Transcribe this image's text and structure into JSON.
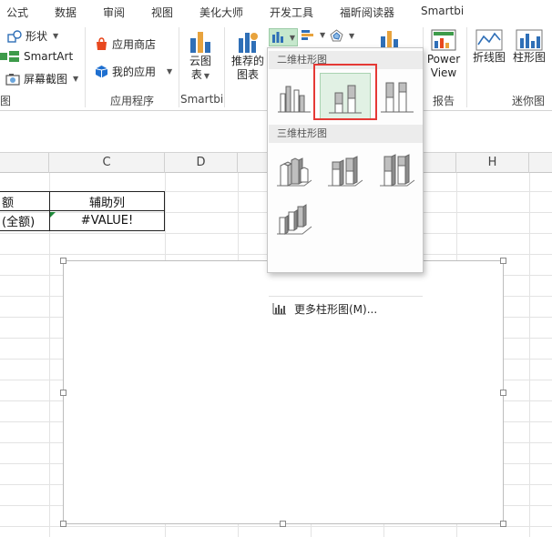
{
  "tabs": [
    "公式",
    "数据",
    "审阅",
    "视图",
    "美化大师",
    "开发工具",
    "福昕阅读器",
    "Smartbi"
  ],
  "ribbon": {
    "illustrations": {
      "shapes_label": "形状",
      "smartart_label": "SmartArt",
      "screenshot_label": "屏幕截图",
      "group_label_partial": "图"
    },
    "apps": {
      "store_label": "应用商店",
      "myapps_label": "我的应用",
      "group_label": "应用程序"
    },
    "smartbi": {
      "cloud_chart_line1": "云图",
      "cloud_chart_line2": "表",
      "group_label": "Smartbi"
    },
    "charts": {
      "recommended_line1": "推荐的",
      "recommended_line2": "图表"
    },
    "reports": {
      "powerview_line1": "Power",
      "powerview_line2": "View",
      "group_label": "报告"
    },
    "sparklines": {
      "line_label": "折线图",
      "column_label": "柱形图",
      "group_label": "迷你图"
    }
  },
  "sheet": {
    "columns": [
      "C",
      "D",
      "H"
    ],
    "cells": {
      "b_header_partial": "额",
      "c_header": "辅助列",
      "b_value_partial": "(全额)",
      "c_value": "#VALUE!"
    }
  },
  "dropdown": {
    "section_2d": "二维柱形图",
    "section_3d": "三维柱形图",
    "more_label": "更多柱形图(M)..."
  },
  "colors": {
    "selected_bg": "#e1f1e4",
    "highlight_border": "#e53935",
    "bar_gray": "#bfbfbf",
    "bar_dark": "#7f7f7f"
  }
}
